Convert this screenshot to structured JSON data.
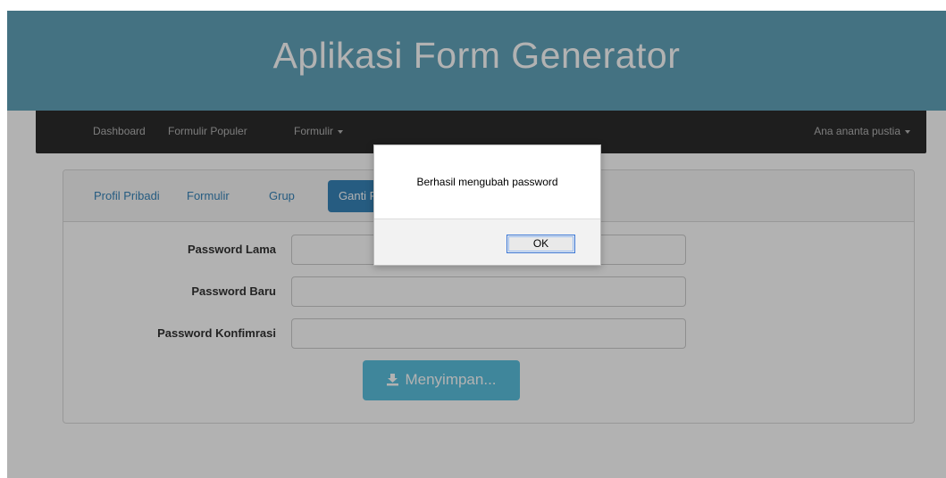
{
  "header": {
    "title": "Aplikasi Form Generator"
  },
  "navbar": {
    "items": [
      {
        "label": "Dashboard"
      },
      {
        "label": "Formulir Populer"
      },
      {
        "label": "Formulir"
      }
    ],
    "user": "Ana ananta pustia"
  },
  "tabs": [
    {
      "label": "Profil Pribadi"
    },
    {
      "label": "Formulir"
    },
    {
      "label": "Grup"
    },
    {
      "label": "Ganti Password",
      "active": true
    }
  ],
  "form": {
    "fields": [
      {
        "label": "Password Lama",
        "value": ""
      },
      {
        "label": "Password Baru",
        "value": ""
      },
      {
        "label": "Password Konfimrasi",
        "value": ""
      }
    ],
    "save_label": "Menyimpan..."
  },
  "dialog": {
    "message": "Berhasil mengubah password",
    "ok_label": "OK"
  },
  "colors": {
    "header_bg": "#62a4bb",
    "navbar_bg": "#2c2c2c",
    "tab_active": "#3784b9",
    "save_button": "#5bc0de"
  }
}
